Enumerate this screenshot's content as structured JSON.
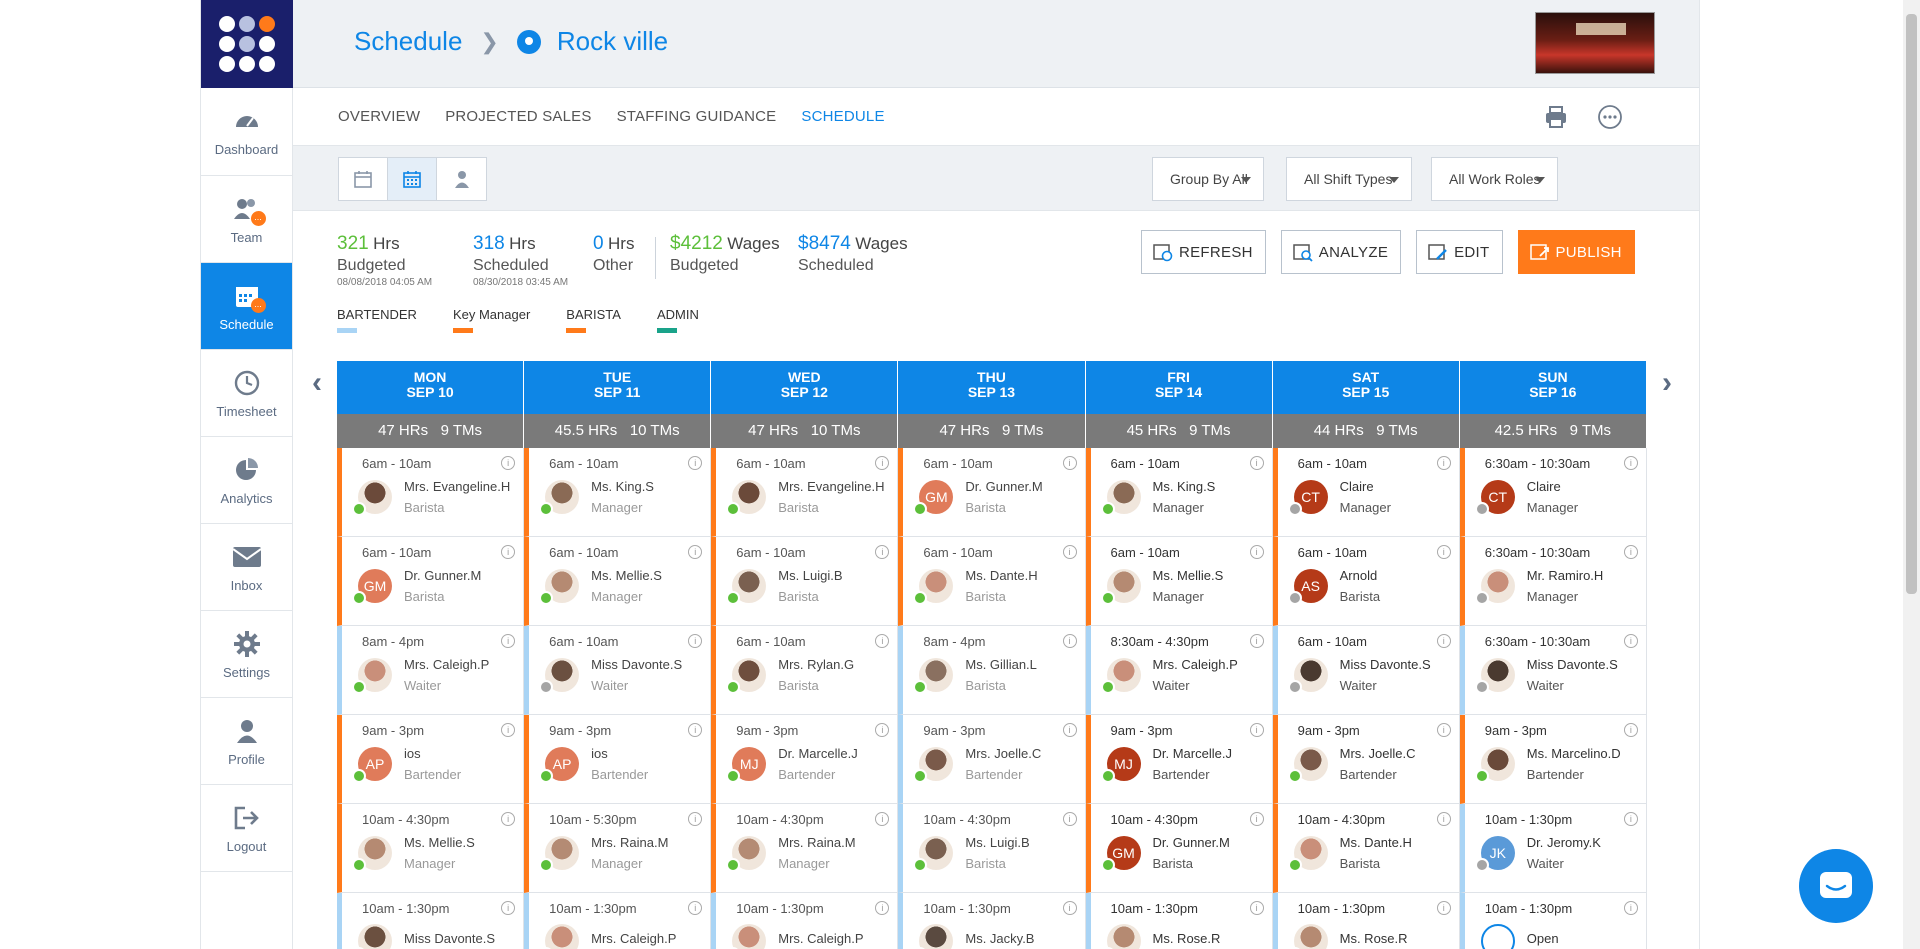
{
  "sidebar": {
    "items": [
      {
        "label": "Dashboard",
        "icon": "dashboard-icon",
        "active": false,
        "badge": ""
      },
      {
        "label": "Team",
        "icon": "team-icon",
        "active": false,
        "badge": "..."
      },
      {
        "label": "Schedule",
        "icon": "calendar-icon",
        "active": true,
        "badge": "..."
      },
      {
        "label": "Timesheet",
        "icon": "clock-icon",
        "active": false,
        "badge": ""
      },
      {
        "label": "Analytics",
        "icon": "pie-chart-icon",
        "active": false,
        "badge": ""
      },
      {
        "label": "Inbox",
        "icon": "envelope-icon",
        "active": false,
        "badge": ""
      },
      {
        "label": "Settings",
        "icon": "gear-icon",
        "active": false,
        "badge": ""
      },
      {
        "label": "Profile",
        "icon": "person-icon",
        "active": false,
        "badge": ""
      },
      {
        "label": "Logout",
        "icon": "logout-icon",
        "active": false,
        "badge": ""
      }
    ]
  },
  "header": {
    "crumb_root": "Schedule",
    "location": "Rock ville"
  },
  "tabs": [
    {
      "label": "OVERVIEW",
      "active": false
    },
    {
      "label": "PROJECTED SALES",
      "active": false
    },
    {
      "label": "STAFFING GUIDANCE",
      "active": false
    },
    {
      "label": "SCHEDULE",
      "active": true
    }
  ],
  "filters": {
    "group": "Group By All",
    "shift_types": "All Shift Types",
    "work_roles": "All Work Roles"
  },
  "stats": {
    "budgeted_hrs": "321",
    "budgeted_hrs_unit": "Hrs",
    "budgeted_label": "Budgeted",
    "budgeted_ts": "08/08/2018 04:05 AM",
    "scheduled_hrs": "318",
    "scheduled_hrs_unit": "Hrs",
    "scheduled_label": "Scheduled",
    "scheduled_ts": "08/30/2018 03:45 AM",
    "other_hrs": "0",
    "other_hrs_unit": "Hrs",
    "other_label": "Other",
    "wages_budgeted": "$4212",
    "wages_budgeted_unit": "Wages",
    "wages_budgeted_label": "Budgeted",
    "wages_scheduled": "$8474",
    "wages_scheduled_unit": "Wages",
    "wages_scheduled_label": "Scheduled"
  },
  "actions": {
    "refresh": "REFRESH",
    "analyze": "ANALYZE",
    "edit": "EDIT",
    "publish": "PUBLISH"
  },
  "legend": [
    {
      "label": "BARTENDER",
      "color": "#a9d4f5"
    },
    {
      "label": "Key Manager",
      "color": "#ff7a1a"
    },
    {
      "label": "BARISTA",
      "color": "#ff7a1a"
    },
    {
      "label": "ADMIN",
      "color": "#1aa38a"
    }
  ],
  "days": [
    {
      "dow": "MON",
      "date": "SEP 10",
      "hrs": "47 HRs",
      "tms": "9 TMs",
      "white": false
    },
    {
      "dow": "TUE",
      "date": "SEP 11",
      "hrs": "45.5 HRs",
      "tms": "10 TMs",
      "white": false
    },
    {
      "dow": "WED",
      "date": "SEP 12",
      "hrs": "47 HRs",
      "tms": "10 TMs",
      "white": false
    },
    {
      "dow": "THU",
      "date": "SEP 13",
      "hrs": "47 HRs",
      "tms": "9 TMs",
      "white": false
    },
    {
      "dow": "FRI",
      "date": "SEP 14",
      "hrs": "45 HRs",
      "tms": "9 TMs",
      "white": true
    },
    {
      "dow": "SAT",
      "date": "SEP 15",
      "hrs": "44 HRs",
      "tms": "9 TMs",
      "white": true
    },
    {
      "dow": "SUN",
      "date": "SEP 16",
      "hrs": "42.5 HRs",
      "tms": "9 TMs",
      "white": true
    }
  ],
  "shifts": [
    [
      {
        "time": "6am - 10am",
        "name": "Mrs. Evangeline.H",
        "role": "Barista",
        "initials": "",
        "avatar_color": "#6b4a3a",
        "status": "green",
        "kind": "o"
      },
      {
        "time": "6am - 10am",
        "name": "Dr. Gunner.M",
        "role": "Barista",
        "initials": "GM",
        "avatar_color": "#e07b5a",
        "status": "green",
        "kind": "o"
      },
      {
        "time": "8am - 4pm",
        "name": "Mrs. Caleigh.P",
        "role": "Waiter",
        "initials": "",
        "avatar_color": "#c98f7a",
        "status": "green",
        "kind": "bt"
      },
      {
        "time": "9am - 3pm",
        "name": "ios",
        "role": "Bartender",
        "initials": "AP",
        "avatar_color": "#e07b5a",
        "status": "green",
        "kind": "o"
      },
      {
        "time": "10am - 4:30pm",
        "name": "Ms. Mellie.S",
        "role": "Manager",
        "initials": "",
        "avatar_color": "#b58a72",
        "status": "green",
        "kind": "o"
      },
      {
        "time": "10am - 1:30pm",
        "name": "Miss Davonte.S",
        "role": "",
        "initials": "",
        "avatar_color": "#6b5040",
        "status": "green",
        "kind": "bt"
      }
    ],
    [
      {
        "time": "6am - 10am",
        "name": "Ms. King.S",
        "role": "Manager",
        "initials": "",
        "avatar_color": "#8a6a55",
        "status": "green",
        "kind": "o"
      },
      {
        "time": "6am - 10am",
        "name": "Ms. Mellie.S",
        "role": "Manager",
        "initials": "",
        "avatar_color": "#b58a72",
        "status": "green",
        "kind": "o"
      },
      {
        "time": "6am - 10am",
        "name": "Miss Davonte.S",
        "role": "Waiter",
        "initials": "",
        "avatar_color": "#6b5040",
        "status": "grey",
        "kind": "bt"
      },
      {
        "time": "9am - 3pm",
        "name": "ios",
        "role": "Bartender",
        "initials": "AP",
        "avatar_color": "#e07b5a",
        "status": "green",
        "kind": "o"
      },
      {
        "time": "10am - 5:30pm",
        "name": "Mrs. Raina.M",
        "role": "Manager",
        "initials": "",
        "avatar_color": "#b48b74",
        "status": "green",
        "kind": "o"
      },
      {
        "time": "10am - 1:30pm",
        "name": "Mrs. Caleigh.P",
        "role": "",
        "initials": "",
        "avatar_color": "#c98f7a",
        "status": "green",
        "kind": "bt"
      }
    ],
    [
      {
        "time": "6am - 10am",
        "name": "Mrs. Evangeline.H",
        "role": "Barista",
        "initials": "",
        "avatar_color": "#6b4a3a",
        "status": "green",
        "kind": "o"
      },
      {
        "time": "6am - 10am",
        "name": "Ms. Luigi.B",
        "role": "Barista",
        "initials": "",
        "avatar_color": "#7a6050",
        "status": "green",
        "kind": "o"
      },
      {
        "time": "6am - 10am",
        "name": "Mrs. Rylan.G",
        "role": "Barista",
        "initials": "",
        "avatar_color": "#6e4e3e",
        "status": "green",
        "kind": "o"
      },
      {
        "time": "9am - 3pm",
        "name": "Dr. Marcelle.J",
        "role": "Bartender",
        "initials": "MJ",
        "avatar_color": "#e07b5a",
        "status": "green",
        "kind": "o"
      },
      {
        "time": "10am - 4:30pm",
        "name": "Mrs. Raina.M",
        "role": "Manager",
        "initials": "",
        "avatar_color": "#b48b74",
        "status": "green",
        "kind": "o"
      },
      {
        "time": "10am - 1:30pm",
        "name": "Mrs. Caleigh.P",
        "role": "",
        "initials": "",
        "avatar_color": "#c98f7a",
        "status": "green",
        "kind": "bt"
      }
    ],
    [
      {
        "time": "6am - 10am",
        "name": "Dr. Gunner.M",
        "role": "Barista",
        "initials": "GM",
        "avatar_color": "#e07b5a",
        "status": "green",
        "kind": "o"
      },
      {
        "time": "6am - 10am",
        "name": "Ms. Dante.H",
        "role": "Barista",
        "initials": "",
        "avatar_color": "#c98f7a",
        "status": "green",
        "kind": "o"
      },
      {
        "time": "8am - 4pm",
        "name": "Ms. Gillian.L",
        "role": "Barista",
        "initials": "",
        "avatar_color": "#8a7060",
        "status": "green",
        "kind": "bt"
      },
      {
        "time": "9am - 3pm",
        "name": "Mrs. Joelle.C",
        "role": "Bartender",
        "initials": "",
        "avatar_color": "#7a5a4a",
        "status": "green",
        "kind": "bt"
      },
      {
        "time": "10am - 4:30pm",
        "name": "Ms. Luigi.B",
        "role": "Barista",
        "initials": "",
        "avatar_color": "#7a6050",
        "status": "green",
        "kind": "bt"
      },
      {
        "time": "10am - 1:30pm",
        "name": "Ms. Jacky.B",
        "role": "",
        "initials": "",
        "avatar_color": "#5a4a40",
        "status": "green",
        "kind": "bt"
      }
    ],
    [
      {
        "time": "6am - 10am",
        "name": "Ms. King.S",
        "role": "Manager",
        "initials": "",
        "avatar_color": "#8a6a55",
        "status": "green",
        "kind": "o"
      },
      {
        "time": "6am - 10am",
        "name": "Ms. Mellie.S",
        "role": "Manager",
        "initials": "",
        "avatar_color": "#b58a72",
        "status": "green",
        "kind": "o"
      },
      {
        "time": "8:30am - 4:30pm",
        "name": "Mrs. Caleigh.P",
        "role": "Waiter",
        "initials": "",
        "avatar_color": "#c98f7a",
        "status": "green",
        "kind": "bt"
      },
      {
        "time": "9am - 3pm",
        "name": "Dr. Marcelle.J",
        "role": "Bartender",
        "initials": "MJ",
        "avatar_color": "#b53a18",
        "status": "green",
        "kind": "o"
      },
      {
        "time": "10am - 4:30pm",
        "name": "Dr. Gunner.M",
        "role": "Barista",
        "initials": "GM",
        "avatar_color": "#b53a18",
        "status": "green",
        "kind": "o"
      },
      {
        "time": "10am - 1:30pm",
        "name": "Ms. Rose.R",
        "role": "",
        "initials": "",
        "avatar_color": "#b58a72",
        "status": "green",
        "kind": "bt"
      }
    ],
    [
      {
        "time": "6am - 10am",
        "name": "Claire",
        "role": "Manager",
        "initials": "CT",
        "avatar_color": "#b53a18",
        "status": "grey",
        "kind": "o"
      },
      {
        "time": "6am - 10am",
        "name": "Arnold",
        "role": "Barista",
        "initials": "AS",
        "avatar_color": "#b53a18",
        "status": "grey",
        "kind": "o"
      },
      {
        "time": "6am - 10am",
        "name": "Miss Davonte.S",
        "role": "Waiter",
        "initials": "",
        "avatar_color": "#4a3a30",
        "status": "grey",
        "kind": "bt"
      },
      {
        "time": "9am - 3pm",
        "name": "Mrs. Joelle.C",
        "role": "Bartender",
        "initials": "",
        "avatar_color": "#7a5a4a",
        "status": "green",
        "kind": "o"
      },
      {
        "time": "10am - 4:30pm",
        "name": "Ms. Dante.H",
        "role": "Barista",
        "initials": "",
        "avatar_color": "#c98f7a",
        "status": "green",
        "kind": "o"
      },
      {
        "time": "10am - 1:30pm",
        "name": "Ms. Rose.R",
        "role": "",
        "initials": "",
        "avatar_color": "#b58a72",
        "status": "green",
        "kind": "bt"
      }
    ],
    [
      {
        "time": "6:30am - 10:30am",
        "name": "Claire",
        "role": "Manager",
        "initials": "CT",
        "avatar_color": "#b53a18",
        "status": "grey",
        "kind": "o"
      },
      {
        "time": "6:30am - 10:30am",
        "name": "Mr. Ramiro.H",
        "role": "Manager",
        "initials": "",
        "avatar_color": "#c98f7a",
        "status": "grey",
        "kind": "o"
      },
      {
        "time": "6:30am - 10:30am",
        "name": "Miss Davonte.S",
        "role": "Waiter",
        "initials": "",
        "avatar_color": "#4a3a30",
        "status": "grey",
        "kind": "bt"
      },
      {
        "time": "9am - 3pm",
        "name": "Ms. Marcelino.D",
        "role": "Bartender",
        "initials": "",
        "avatar_color": "#6a4a3a",
        "status": "green",
        "kind": "o"
      },
      {
        "time": "10am - 1:30pm",
        "name": "Dr. Jeromy.K",
        "role": "Waiter",
        "initials": "JK",
        "avatar_color": "#5a9ad8",
        "status": "grey",
        "kind": "bt"
      },
      {
        "time": "10am - 1:30pm",
        "name": "Open",
        "role": "",
        "initials": "",
        "avatar_color": "#ffffff",
        "status": "none",
        "kind": "bt"
      }
    ]
  ]
}
